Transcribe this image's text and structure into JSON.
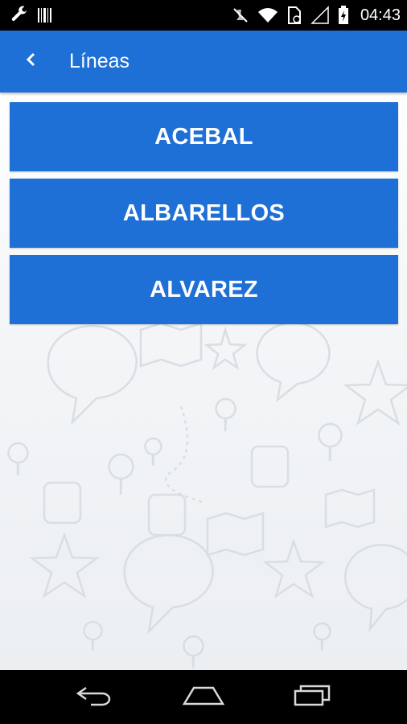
{
  "status_bar": {
    "time": "04:43",
    "icons": [
      "wrench-icon",
      "barcode-icon",
      "mute-icon",
      "wifi-icon",
      "sim-icon",
      "signal-icon",
      "battery-icon"
    ]
  },
  "app_bar": {
    "title": "Líneas",
    "back_icon": "chevron-left-icon"
  },
  "lines": [
    {
      "label": "ACEBAL"
    },
    {
      "label": "ALBARELLOS"
    },
    {
      "label": "ALVAREZ"
    }
  ],
  "nav_bar": {
    "icons": [
      "back-icon",
      "home-icon",
      "recents-icon"
    ]
  },
  "colors": {
    "primary": "#1e6fd6",
    "status_bar": "#000000",
    "nav_bar": "#000000",
    "text_on_primary": "#ffffff"
  }
}
